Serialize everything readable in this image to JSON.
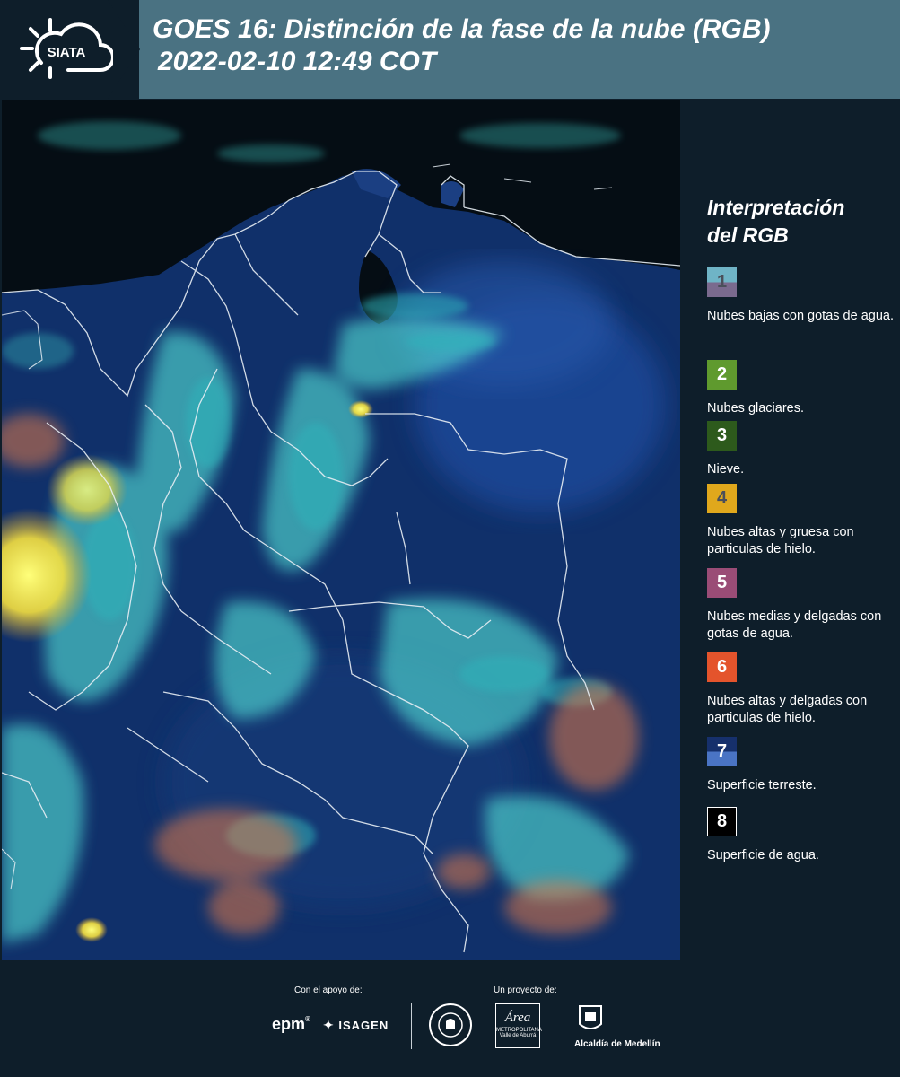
{
  "header": {
    "logo_text": "SIATA",
    "title_line1": "GOES 16: Distinción de la fase de la nube (RGB)",
    "title_line2": "2022-02-10 12:49 COT"
  },
  "legend": {
    "title_line1": "Interpretación",
    "title_line2": "del RGB",
    "items": [
      {
        "num": "1",
        "label": "Nubes bajas con gotas de agua.",
        "color_top": "#6fb4c6",
        "color_bottom": "#7a6a8e"
      },
      {
        "num": "2",
        "label": "Nubes glaciares.",
        "color": "#5f9a2e"
      },
      {
        "num": "3",
        "label": "Nieve.",
        "color": "#2d5a1c"
      },
      {
        "num": "4",
        "label": "Nubes altas y gruesa con particulas de hielo.",
        "color": "#e0a81c"
      },
      {
        "num": "5",
        "label": "Nubes medias y delgadas con gotas de agua.",
        "color": "#9a4c76"
      },
      {
        "num": "6",
        "label": "Nubes altas y delgadas con particulas de hielo.",
        "color": "#e4542c"
      },
      {
        "num": "7",
        "label": "Superficie terreste.",
        "color_top": "#16306c",
        "color_bottom": "#4a74c4"
      },
      {
        "num": "8",
        "label": "Superficie de agua.",
        "color": "#000000"
      }
    ]
  },
  "footer": {
    "support_caption": "Con el apoyo de:",
    "project_caption": "Un proyecto de:",
    "sponsor_epm": "epm",
    "sponsor_isagen": "ISAGEN",
    "area_logo": "Área",
    "area_line1": "METROPOLITANA",
    "area_line2": "Valle de Aburrá",
    "alcaldia": "Alcaldía de Medellín"
  }
}
